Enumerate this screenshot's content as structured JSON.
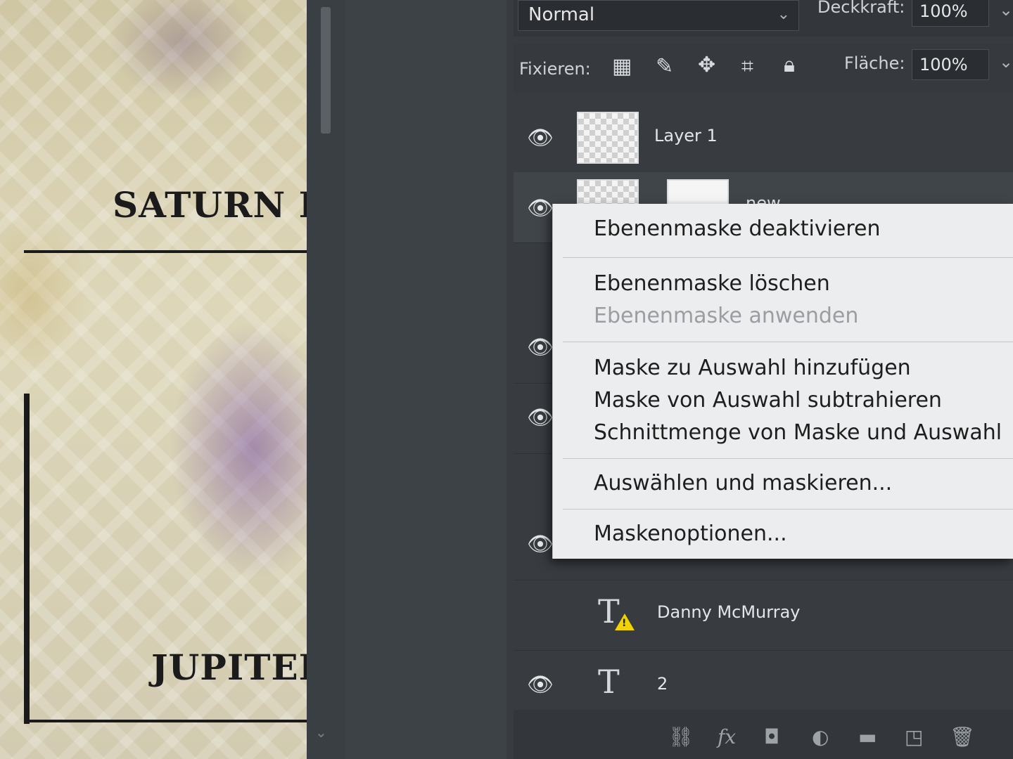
{
  "canvas": {
    "texts": [
      "SATURN I",
      "JUPITER"
    ]
  },
  "layers_panel": {
    "blend_mode": "Normal",
    "opacity_label": "Deckkraft:",
    "opacity_value": "100%",
    "lock_label": "Fixieren:",
    "fill_label": "Fläche:",
    "fill_value": "100%",
    "lock_icons": [
      "lock-transparent-icon",
      "lock-paint-icon",
      "lock-move-icon",
      "lock-artboard-icon",
      "lock-all-icon"
    ],
    "layers": [
      {
        "name": "Layer 1",
        "visible": true,
        "kind": "smart-object"
      },
      {
        "name": "new",
        "visible": true,
        "kind": "masked"
      },
      {
        "name": "Danny McMurray",
        "visible": false,
        "kind": "text-warning"
      },
      {
        "name": "2",
        "visible": true,
        "kind": "text"
      }
    ],
    "bottom_icons": [
      "link-icon",
      "fx-icon",
      "mask-icon",
      "adjustment-icon",
      "folder-icon",
      "new-layer-icon",
      "trash-icon"
    ]
  },
  "context_menu": {
    "items": [
      {
        "label": "Ebenenmaske deaktivieren",
        "enabled": true
      },
      {
        "label": "Ebenenmaske löschen",
        "enabled": true
      },
      {
        "label": "Ebenenmaske anwenden",
        "enabled": false
      },
      {
        "label": "Maske zu Auswahl hinzufügen",
        "enabled": true
      },
      {
        "label": "Maske von Auswahl subtrahieren",
        "enabled": true
      },
      {
        "label": "Schnittmenge von Maske und Auswahl",
        "enabled": true
      },
      {
        "label": "Auswählen und maskieren...",
        "enabled": true
      },
      {
        "label": "Maskenoptionen...",
        "enabled": true
      }
    ]
  },
  "colors": {
    "panel_bg": "#383c41",
    "menu_bg": "#ecedee",
    "warning": "#f2d300"
  }
}
